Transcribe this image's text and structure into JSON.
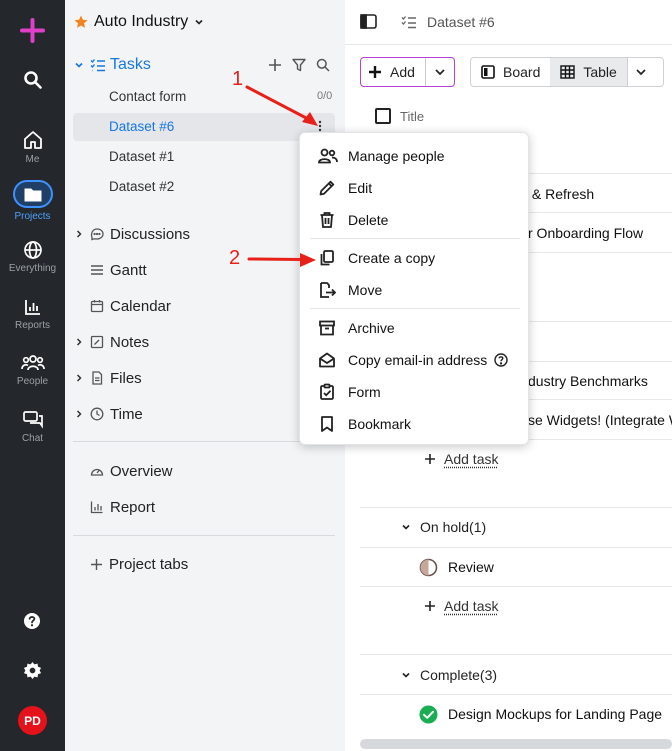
{
  "rail": {
    "items": [
      {
        "label": "Me",
        "icon": "home-icon"
      },
      {
        "label": "Projects",
        "icon": "folder-icon"
      },
      {
        "label": "Everything",
        "icon": "globe-icon"
      },
      {
        "label": "Reports",
        "icon": "bar-chart-icon"
      },
      {
        "label": "People",
        "icon": "people-icon"
      },
      {
        "label": "Chat",
        "icon": "chat-icon"
      }
    ],
    "avatar": "PD",
    "colors": {
      "add": "#e040c8",
      "active": "#3e92ff",
      "avatar": "#e5121b"
    }
  },
  "sidebar": {
    "project_title": "Auto Industry",
    "tasks": {
      "label": "Tasks",
      "items": [
        {
          "label": "Contact form",
          "count": "0/0"
        },
        {
          "label": "Dataset #6"
        },
        {
          "label": "Dataset #1"
        },
        {
          "label": "Dataset #2"
        }
      ]
    },
    "nav": [
      {
        "label": "Discussions"
      },
      {
        "label": "Gantt"
      },
      {
        "label": "Calendar"
      },
      {
        "label": "Notes"
      },
      {
        "label": "Files"
      },
      {
        "label": "Time"
      }
    ],
    "extra": [
      {
        "label": "Overview"
      },
      {
        "label": "Report"
      }
    ],
    "project_tabs": "Project tabs"
  },
  "main": {
    "breadcrumb": "Dataset #6",
    "toolbar": {
      "add": "Add",
      "board": "Board",
      "table": "Table"
    },
    "column_title": "Title",
    "rows": [
      "it & Refresh",
      "r Onboarding Flow",
      "dustry Benchmarks",
      "se Widgets! (Integrate W"
    ],
    "add_task": "Add task",
    "groups": {
      "on_hold": {
        "name": "On hold",
        "count": "(1)",
        "tasks": [
          "Review"
        ]
      },
      "complete": {
        "name": "Complete",
        "count": "(3)",
        "tasks": [
          "Design Mockups for Landing Page"
        ]
      }
    }
  },
  "menu": {
    "items": [
      {
        "label": "Manage people",
        "icon": "manage-people-icon"
      },
      {
        "label": "Edit",
        "icon": "pencil-icon"
      },
      {
        "label": "Delete",
        "icon": "trash-icon"
      },
      {
        "label": "Create a copy",
        "icon": "copy-icon"
      },
      {
        "label": "Move",
        "icon": "move-icon"
      },
      {
        "label": "Archive",
        "icon": "archive-icon"
      },
      {
        "label": "Copy email-in address",
        "icon": "email-icon"
      },
      {
        "label": "Form",
        "icon": "clipboard-icon"
      },
      {
        "label": "Bookmark",
        "icon": "bookmark-icon"
      }
    ]
  },
  "annotations": {
    "step1": "1",
    "step2": "2",
    "color": "#e8201a"
  }
}
